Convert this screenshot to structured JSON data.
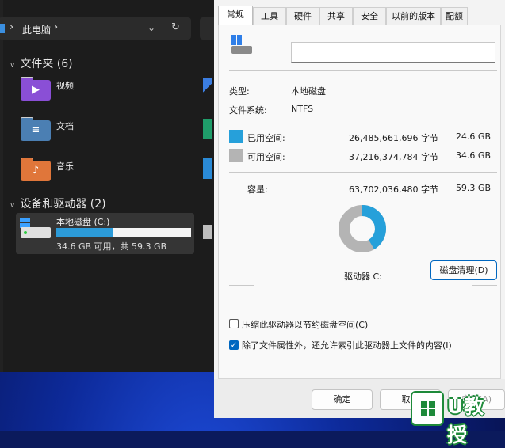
{
  "explorer": {
    "breadcrumb": [
      "此电脑"
    ],
    "folders_section": "文件夹 (6)",
    "folders": [
      {
        "label": "视频",
        "icon": "video-folder-icon",
        "color": "#8a4fd6",
        "glyph": "▶"
      },
      {
        "label": "文档",
        "icon": "documents-folder-icon",
        "color": "#4b7fb3",
        "glyph": "≡"
      },
      {
        "label": "音乐",
        "icon": "music-folder-icon",
        "color": "#e0763a",
        "glyph": "♪"
      }
    ],
    "devices_section": "设备和驱动器 (2)",
    "drive": {
      "name": "本地磁盘 (C:)",
      "free_text": "34.6 GB 可用，共 59.3 GB",
      "used_fraction": 0.417
    }
  },
  "dialog": {
    "tabs": [
      {
        "label": "常规",
        "active": true
      },
      {
        "label": "工具",
        "active": false
      },
      {
        "label": "硬件",
        "active": false
      },
      {
        "label": "共享",
        "active": false
      },
      {
        "label": "安全",
        "active": false
      },
      {
        "label": "以前的版本",
        "active": false
      },
      {
        "label": "配额",
        "active": false
      }
    ],
    "volume_name_value": "",
    "type_label": "类型:",
    "type_value": "本地磁盘",
    "fs_label": "文件系统:",
    "fs_value": "NTFS",
    "used": {
      "label": "已用空间:",
      "bytes": "26,485,661,696 字节",
      "gb": "24.6 GB",
      "color": "#26a0da"
    },
    "free": {
      "label": "可用空间:",
      "bytes": "37,216,374,784 字节",
      "gb": "34.6 GB",
      "color": "#b4b4b4"
    },
    "capacity": {
      "label": "容量:",
      "bytes": "63,702,036,480 字节",
      "gb": "59.3 GB"
    },
    "drive_label": "驱动器 C:",
    "cleanup_button": "磁盘清理(D)",
    "compress_label": "压缩此驱动器以节约磁盘空间(C)",
    "compress_checked": false,
    "index_label": "除了文件属性外，还允许索引此驱动器上文件的内容(I)",
    "index_checked": true,
    "ok_button": "确定",
    "cancel_button": "取消",
    "apply_button": "应用(A)"
  },
  "watermark": {
    "text": "U教授"
  }
}
